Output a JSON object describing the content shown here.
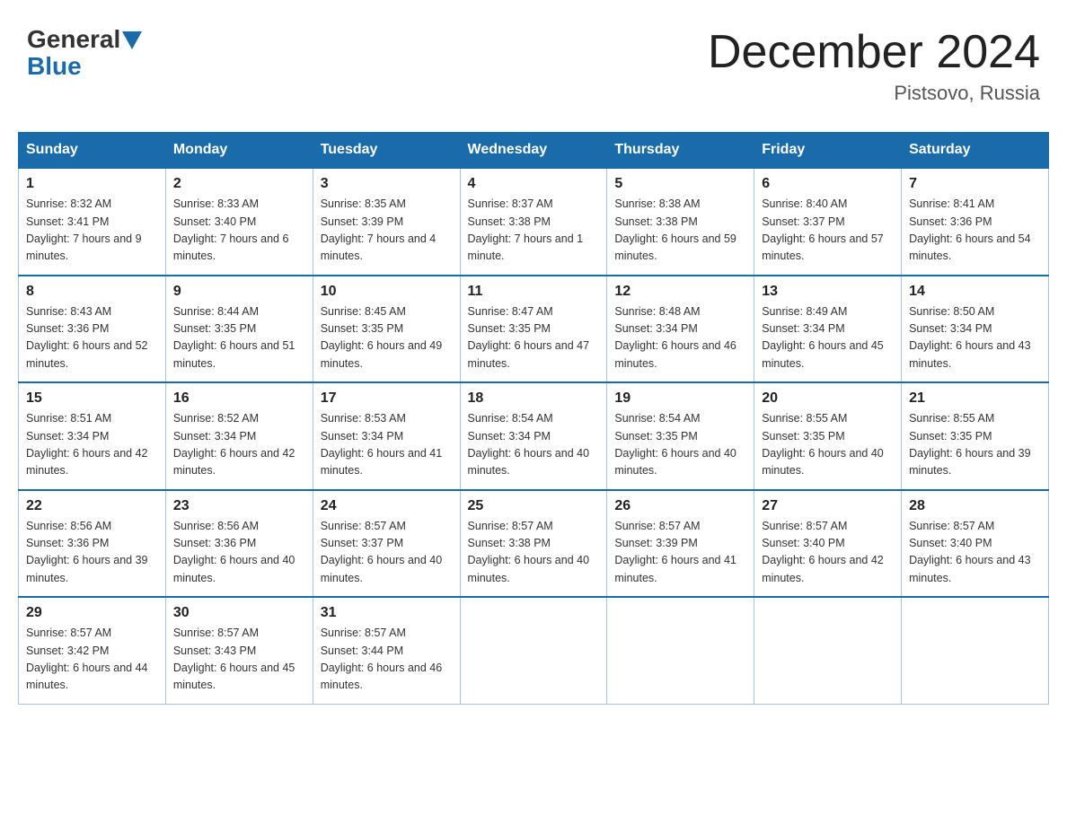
{
  "header": {
    "logo_line1": "General",
    "logo_line2": "Blue",
    "month_title": "December 2024",
    "location": "Pistsovo, Russia"
  },
  "days_of_week": [
    "Sunday",
    "Monday",
    "Tuesday",
    "Wednesday",
    "Thursday",
    "Friday",
    "Saturday"
  ],
  "weeks": [
    [
      {
        "day": 1,
        "sunrise": "8:32 AM",
        "sunset": "3:41 PM",
        "daylight": "7 hours and 9 minutes."
      },
      {
        "day": 2,
        "sunrise": "8:33 AM",
        "sunset": "3:40 PM",
        "daylight": "7 hours and 6 minutes."
      },
      {
        "day": 3,
        "sunrise": "8:35 AM",
        "sunset": "3:39 PM",
        "daylight": "7 hours and 4 minutes."
      },
      {
        "day": 4,
        "sunrise": "8:37 AM",
        "sunset": "3:38 PM",
        "daylight": "7 hours and 1 minute."
      },
      {
        "day": 5,
        "sunrise": "8:38 AM",
        "sunset": "3:38 PM",
        "daylight": "6 hours and 59 minutes."
      },
      {
        "day": 6,
        "sunrise": "8:40 AM",
        "sunset": "3:37 PM",
        "daylight": "6 hours and 57 minutes."
      },
      {
        "day": 7,
        "sunrise": "8:41 AM",
        "sunset": "3:36 PM",
        "daylight": "6 hours and 54 minutes."
      }
    ],
    [
      {
        "day": 8,
        "sunrise": "8:43 AM",
        "sunset": "3:36 PM",
        "daylight": "6 hours and 52 minutes."
      },
      {
        "day": 9,
        "sunrise": "8:44 AM",
        "sunset": "3:35 PM",
        "daylight": "6 hours and 51 minutes."
      },
      {
        "day": 10,
        "sunrise": "8:45 AM",
        "sunset": "3:35 PM",
        "daylight": "6 hours and 49 minutes."
      },
      {
        "day": 11,
        "sunrise": "8:47 AM",
        "sunset": "3:35 PM",
        "daylight": "6 hours and 47 minutes."
      },
      {
        "day": 12,
        "sunrise": "8:48 AM",
        "sunset": "3:34 PM",
        "daylight": "6 hours and 46 minutes."
      },
      {
        "day": 13,
        "sunrise": "8:49 AM",
        "sunset": "3:34 PM",
        "daylight": "6 hours and 45 minutes."
      },
      {
        "day": 14,
        "sunrise": "8:50 AM",
        "sunset": "3:34 PM",
        "daylight": "6 hours and 43 minutes."
      }
    ],
    [
      {
        "day": 15,
        "sunrise": "8:51 AM",
        "sunset": "3:34 PM",
        "daylight": "6 hours and 42 minutes."
      },
      {
        "day": 16,
        "sunrise": "8:52 AM",
        "sunset": "3:34 PM",
        "daylight": "6 hours and 42 minutes."
      },
      {
        "day": 17,
        "sunrise": "8:53 AM",
        "sunset": "3:34 PM",
        "daylight": "6 hours and 41 minutes."
      },
      {
        "day": 18,
        "sunrise": "8:54 AM",
        "sunset": "3:34 PM",
        "daylight": "6 hours and 40 minutes."
      },
      {
        "day": 19,
        "sunrise": "8:54 AM",
        "sunset": "3:35 PM",
        "daylight": "6 hours and 40 minutes."
      },
      {
        "day": 20,
        "sunrise": "8:55 AM",
        "sunset": "3:35 PM",
        "daylight": "6 hours and 40 minutes."
      },
      {
        "day": 21,
        "sunrise": "8:55 AM",
        "sunset": "3:35 PM",
        "daylight": "6 hours and 39 minutes."
      }
    ],
    [
      {
        "day": 22,
        "sunrise": "8:56 AM",
        "sunset": "3:36 PM",
        "daylight": "6 hours and 39 minutes."
      },
      {
        "day": 23,
        "sunrise": "8:56 AM",
        "sunset": "3:36 PM",
        "daylight": "6 hours and 40 minutes."
      },
      {
        "day": 24,
        "sunrise": "8:57 AM",
        "sunset": "3:37 PM",
        "daylight": "6 hours and 40 minutes."
      },
      {
        "day": 25,
        "sunrise": "8:57 AM",
        "sunset": "3:38 PM",
        "daylight": "6 hours and 40 minutes."
      },
      {
        "day": 26,
        "sunrise": "8:57 AM",
        "sunset": "3:39 PM",
        "daylight": "6 hours and 41 minutes."
      },
      {
        "day": 27,
        "sunrise": "8:57 AM",
        "sunset": "3:40 PM",
        "daylight": "6 hours and 42 minutes."
      },
      {
        "day": 28,
        "sunrise": "8:57 AM",
        "sunset": "3:40 PM",
        "daylight": "6 hours and 43 minutes."
      }
    ],
    [
      {
        "day": 29,
        "sunrise": "8:57 AM",
        "sunset": "3:42 PM",
        "daylight": "6 hours and 44 minutes."
      },
      {
        "day": 30,
        "sunrise": "8:57 AM",
        "sunset": "3:43 PM",
        "daylight": "6 hours and 45 minutes."
      },
      {
        "day": 31,
        "sunrise": "8:57 AM",
        "sunset": "3:44 PM",
        "daylight": "6 hours and 46 minutes."
      },
      null,
      null,
      null,
      null
    ]
  ]
}
